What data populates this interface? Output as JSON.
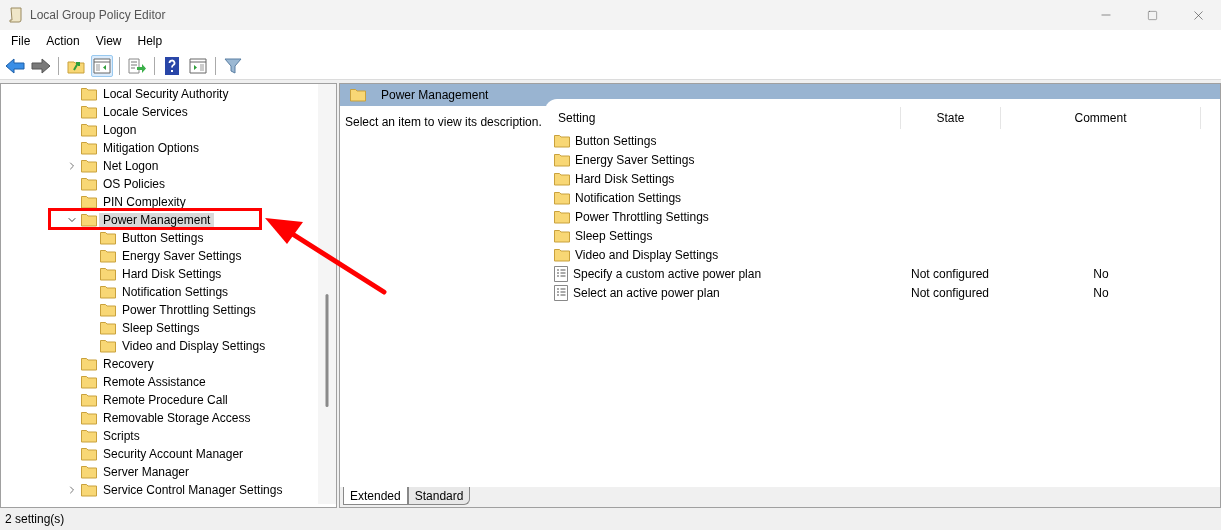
{
  "window": {
    "title": "Local Group Policy Editor"
  },
  "menu": [
    "File",
    "Action",
    "View",
    "Help"
  ],
  "toolbar": [
    {
      "kind": "back",
      "pressed": false
    },
    {
      "kind": "forward",
      "pressed": false
    },
    {
      "kind": "separator"
    },
    {
      "kind": "up",
      "pressed": false
    },
    {
      "kind": "tree",
      "pressed": true
    },
    {
      "kind": "separator"
    },
    {
      "kind": "export",
      "pressed": false
    },
    {
      "kind": "separator"
    },
    {
      "kind": "help",
      "pressed": false
    },
    {
      "kind": "pane",
      "pressed": false
    },
    {
      "kind": "separator"
    },
    {
      "kind": "filter",
      "pressed": false
    }
  ],
  "tree": [
    {
      "label": "Local Security Authority",
      "selected": false
    },
    {
      "label": "Locale Services",
      "selected": false
    },
    {
      "label": "Logon",
      "selected": false
    },
    {
      "label": "Mitigation Options",
      "selected": false
    },
    {
      "label": "Net Logon",
      "expanded": false,
      "selected": false
    },
    {
      "label": "OS Policies",
      "selected": false
    },
    {
      "label": "PIN Complexity",
      "selected": false
    },
    {
      "label": "Power Management",
      "expanded": true,
      "selected": true,
      "children": [
        {
          "label": "Button Settings",
          "selected": false
        },
        {
          "label": "Energy Saver Settings",
          "selected": false
        },
        {
          "label": "Hard Disk Settings",
          "selected": false
        },
        {
          "label": "Notification Settings",
          "selected": false
        },
        {
          "label": "Power Throttling Settings",
          "selected": false
        },
        {
          "label": "Sleep Settings",
          "selected": false
        },
        {
          "label": "Video and Display Settings",
          "selected": false
        }
      ]
    },
    {
      "label": "Recovery",
      "selected": false
    },
    {
      "label": "Remote Assistance",
      "selected": false
    },
    {
      "label": "Remote Procedure Call",
      "selected": false
    },
    {
      "label": "Removable Storage Access",
      "selected": false
    },
    {
      "label": "Scripts",
      "selected": false
    },
    {
      "label": "Security Account Manager",
      "selected": false
    },
    {
      "label": "Server Manager",
      "selected": false
    },
    {
      "label": "Service Control Manager Settings",
      "expanded": false,
      "selected": false
    }
  ],
  "details": {
    "header": "Power Management",
    "description": "Select an item to view its description.",
    "columns": [
      "Setting",
      "State",
      "Comment"
    ],
    "rows": [
      {
        "kind": "folder",
        "setting": "Button Settings"
      },
      {
        "kind": "folder",
        "setting": "Energy Saver Settings"
      },
      {
        "kind": "folder",
        "setting": "Hard Disk Settings"
      },
      {
        "kind": "folder",
        "setting": "Notification Settings"
      },
      {
        "kind": "folder",
        "setting": "Power Throttling Settings"
      },
      {
        "kind": "folder",
        "setting": "Sleep Settings"
      },
      {
        "kind": "folder",
        "setting": "Video and Display Settings"
      },
      {
        "kind": "policy",
        "setting": "Specify a custom active power plan",
        "state": "Not configured",
        "comment": "No"
      },
      {
        "kind": "policy",
        "setting": "Select an active power plan",
        "state": "Not configured",
        "comment": "No"
      }
    ]
  },
  "tabs": [
    {
      "label": "Extended",
      "selected": true
    },
    {
      "label": "Standard",
      "selected": false
    }
  ],
  "status_bar": "2 setting(s)"
}
